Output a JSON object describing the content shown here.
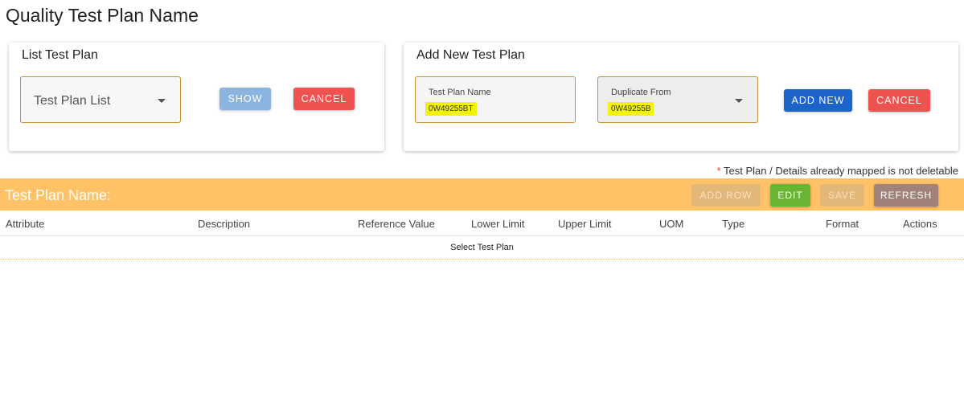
{
  "page": {
    "title": "Quality Test Plan Name"
  },
  "list_card": {
    "title": "List Test Plan",
    "select_value": "Test Plan List",
    "show_label": "SHOW",
    "cancel_label": "CANCEL"
  },
  "add_card": {
    "title": "Add New Test Plan",
    "name_field": {
      "label": "Test Plan Name",
      "value": "0W49255BT"
    },
    "duplicate_field": {
      "label": "Duplicate From",
      "value": "0W49255B"
    },
    "add_label": "ADD NEW",
    "cancel_label": "CANCEL"
  },
  "note": {
    "star": "*",
    "text": " Test Plan / Details already mapped is not deletable"
  },
  "detail_bar": {
    "title": "Test Plan Name:",
    "add_row_label": "ADD ROW",
    "edit_label": "EDIT",
    "save_label": "SAVE",
    "refresh_label": "REFRESH"
  },
  "table": {
    "columns": [
      "Attribute",
      "Description",
      "Reference Value",
      "Lower Limit",
      "Upper Limit",
      "UOM",
      "Type",
      "Format",
      "Actions"
    ],
    "empty_message": "Select Test Plan"
  },
  "colors": {
    "accent_bar": "#ffc266",
    "primary": "#1e63c9",
    "danger": "#ef5350",
    "success": "#6ab434",
    "highlight": "#f2f20a"
  }
}
